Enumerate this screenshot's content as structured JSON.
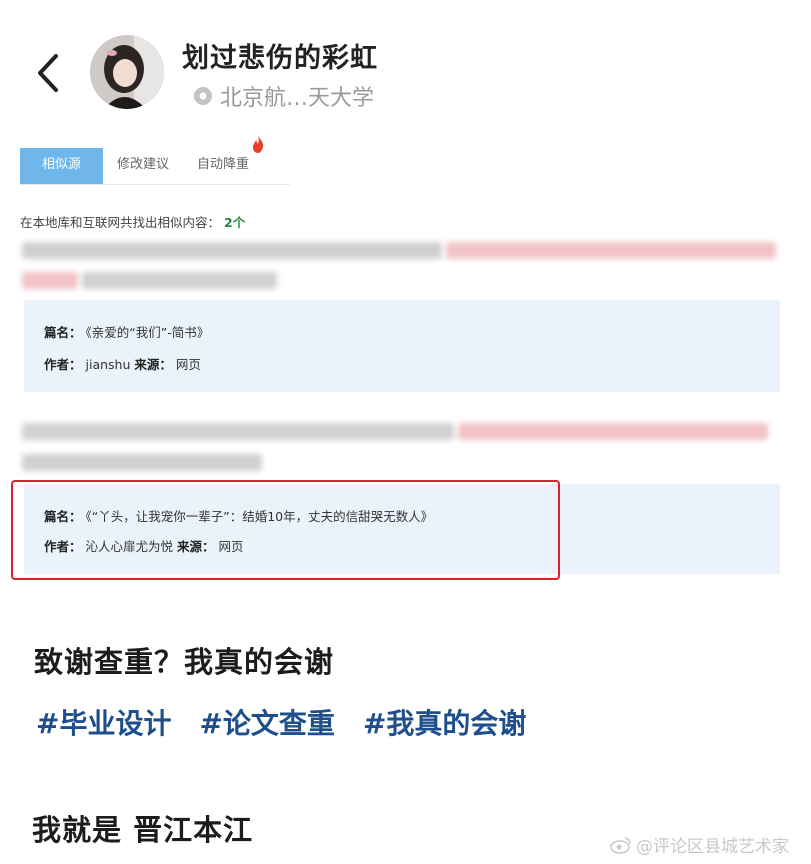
{
  "header": {
    "username": "划过悲伤的彩虹",
    "location": "北京航…天大学"
  },
  "screenshot": {
    "tabs": [
      {
        "label": "相似源",
        "active": true
      },
      {
        "label": "修改建议",
        "active": false
      },
      {
        "label": "自动降重",
        "active": false
      }
    ],
    "found_text": "在本地库和互联网共找出相似内容：",
    "found_count": "2个",
    "results": [
      {
        "title_label": "篇名：",
        "title_value": "《亲爱的“我们”-简书》",
        "author_label": "作者：",
        "author_value": "jianshu",
        "source_label": "来源：",
        "source_value": "网页"
      },
      {
        "title_label": "篇名：",
        "title_value": "《“丫头，让我宠你一辈子”：结婚10年，丈夫的信甜哭无数人》",
        "author_label": "作者：",
        "author_value": "沁人心扉尤为悦",
        "source_label": "来源：",
        "source_value": "网页"
      }
    ]
  },
  "post": {
    "title": "致谢查重？我真的会谢",
    "tags": [
      "#毕业设计",
      "#论文查重",
      "#我真的会谢"
    ],
    "body": "我就是 晋江本江"
  },
  "watermark": "@评论区县城艺术家",
  "colors": {
    "tab_active": "#6fb6ea",
    "card_bg": "#eaf3fb",
    "highlight_border": "#d6252a",
    "tag": "#1e4e8c",
    "count": "#2a8a3e"
  }
}
